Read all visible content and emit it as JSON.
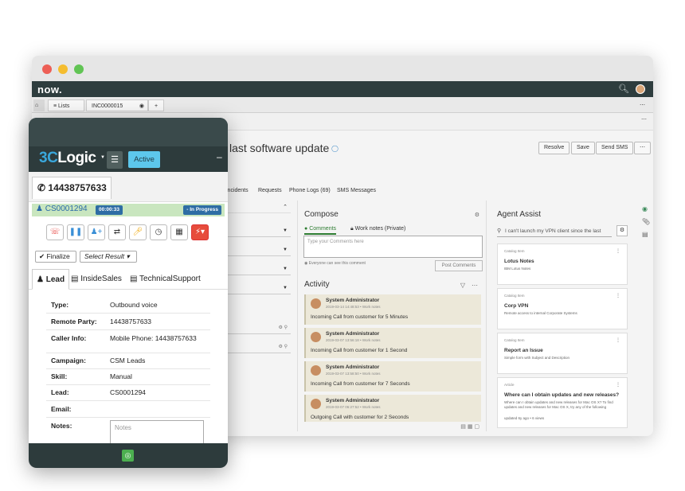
{
  "browser": {
    "colors": {
      "close": "#ed5f56",
      "minimize": "#f5bd2f",
      "maximize": "#61c454",
      "sn_bar": "#2e3d3e"
    },
    "sn_logo": "now.",
    "tabs": [
      {
        "label": "≡ Lists"
      },
      {
        "label": "INC0000015"
      }
    ],
    "record_title": "last software update",
    "header_buttons": [
      "Resolve",
      "Save",
      "Send SMS"
    ],
    "related_tabs": [
      "incidents",
      "Requests",
      "Phone Logs (69)",
      "SMS Messages"
    ]
  },
  "compose": {
    "title": "Compose",
    "tab_comments": "Comments",
    "tab_work_notes": "Work notes (Private)",
    "comment_placeholder": "Type your Comments here",
    "visibility_note": "Everyone can see this comment",
    "post_label": "Post Comments"
  },
  "activity": {
    "title": "Activity",
    "entries": [
      {
        "author": "System Administrator",
        "meta": "2019-03-14 14:48:53 • Work notes",
        "message": "Incoming Call from customer for 5 Minutes"
      },
      {
        "author": "System Administrator",
        "meta": "2019-03-07 13:56:18 • Work notes",
        "message": "Incoming Call from customer for 1 Second"
      },
      {
        "author": "System Administrator",
        "meta": "2019-03-07 13:58:50 • Work notes",
        "message": "Incoming Call from customer for 7 Seconds"
      },
      {
        "author": "System Administrator",
        "meta": "2019-03-07 06:27:52 • Work notes",
        "message": "Outgoing Call with customer for 2 Seconds"
      }
    ]
  },
  "assist": {
    "title": "Agent Assist",
    "search_value": "I can't launch my VPN client since the last",
    "cards": [
      {
        "kind": "Catalog Item",
        "title": "Lotus Notes",
        "desc": "IBM Lotus Notes"
      },
      {
        "kind": "Catalog Item",
        "title": "Corp VPN",
        "desc": "Remote access to internal Corporate Systems"
      },
      {
        "kind": "Catalog Item",
        "title": "Report an Issue",
        "desc": "Simple form with Subject and Description"
      },
      {
        "kind": "Article",
        "title": "Where can I obtain updates and new releases?",
        "desc": "Where can I obtain updates and new releases for Mac OS X? To find updates and new releases for Mac OS X, try any of the following",
        "extra": "updated 6y ago • 6 views"
      }
    ]
  },
  "phone": {
    "logo_three": "3C",
    "logo_rest": "Logic",
    "status": "Active",
    "line_number": "14438757633",
    "case_id": "CS0001294",
    "timer": "00:00:33",
    "call_state": "- In Progress",
    "finalize_label": "Finalize",
    "result_label": "Select Result",
    "tabs": [
      "Lead",
      "InsideSales",
      "TechnicalSupport"
    ],
    "fields": [
      {
        "k": "Type:",
        "v": "Outbound voice"
      },
      {
        "k": "Remote Party:",
        "v": "14438757633"
      },
      {
        "k": "Caller Info:",
        "v": "Mobile Phone: 14438757633"
      },
      {
        "k": "Campaign:",
        "v": "CSM Leads"
      },
      {
        "k": "Skill:",
        "v": "Manual"
      },
      {
        "k": "Lead:",
        "v": "CS0001294"
      },
      {
        "k": "Email:",
        "v": ""
      },
      {
        "k": "Notes:",
        "v": ""
      }
    ],
    "notes_placeholder": "Notes",
    "colors": {
      "logo_accent": "#3aa7db",
      "status_bg": "#5dc7ec",
      "call_bar": "#c9e6bf",
      "hangup": "#e53935",
      "lightning": "#e74c3c"
    }
  }
}
